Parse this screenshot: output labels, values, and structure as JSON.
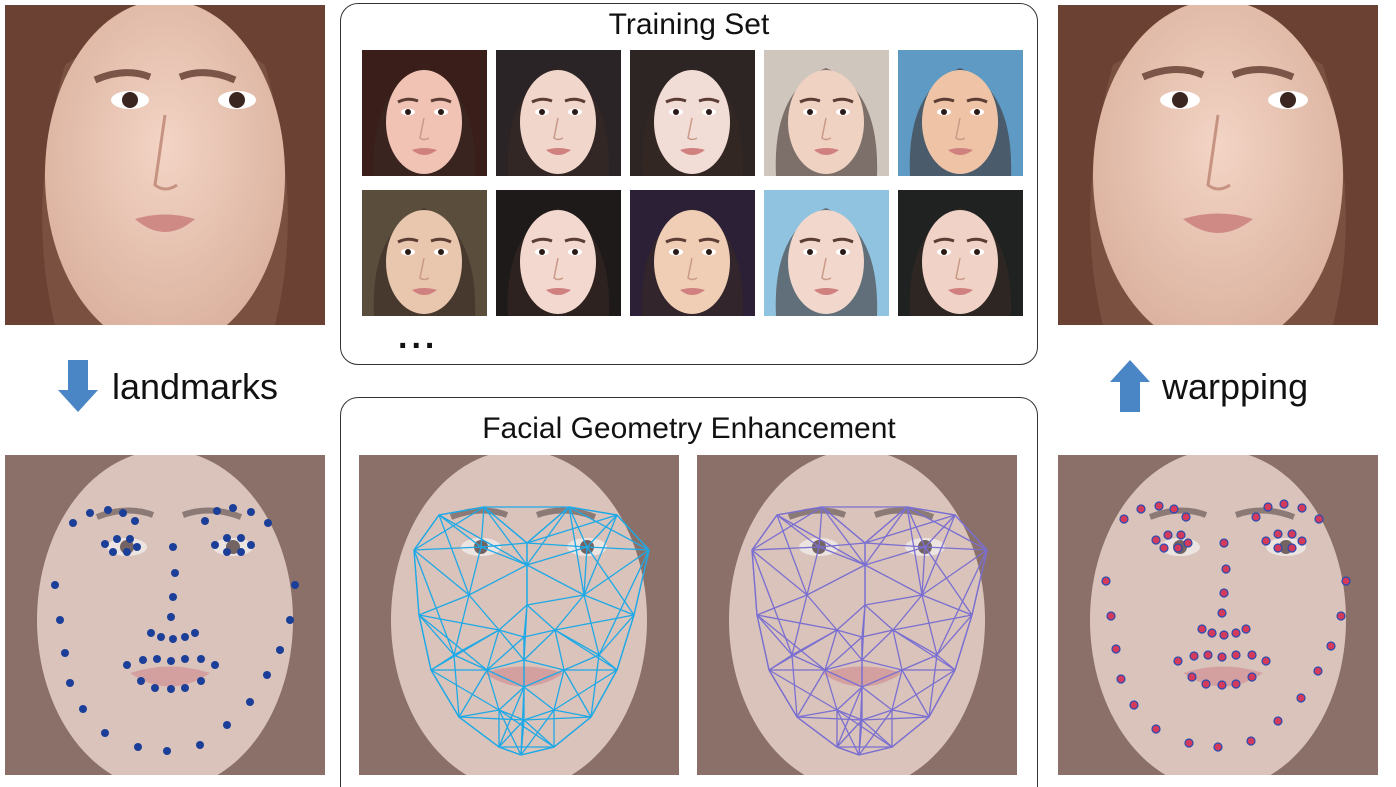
{
  "training_panel": {
    "title": "Training Set",
    "ellipsis": "..."
  },
  "geometry_panel": {
    "title": "Facial Geometry Enhancement"
  },
  "left_step": {
    "label": "landmarks",
    "arrow": "arrow-down-icon"
  },
  "right_step": {
    "label": "warpping",
    "arrow": "arrow-up-icon"
  },
  "colors": {
    "arrow": "#4a86c5",
    "landmark_dot": "#1b3f99",
    "warped_dot_fill": "#d43a5c",
    "warped_dot_stroke": "#2a4bb0",
    "mesh_left": "#1ea9e6",
    "mesh_right": "#7a6fd0"
  }
}
